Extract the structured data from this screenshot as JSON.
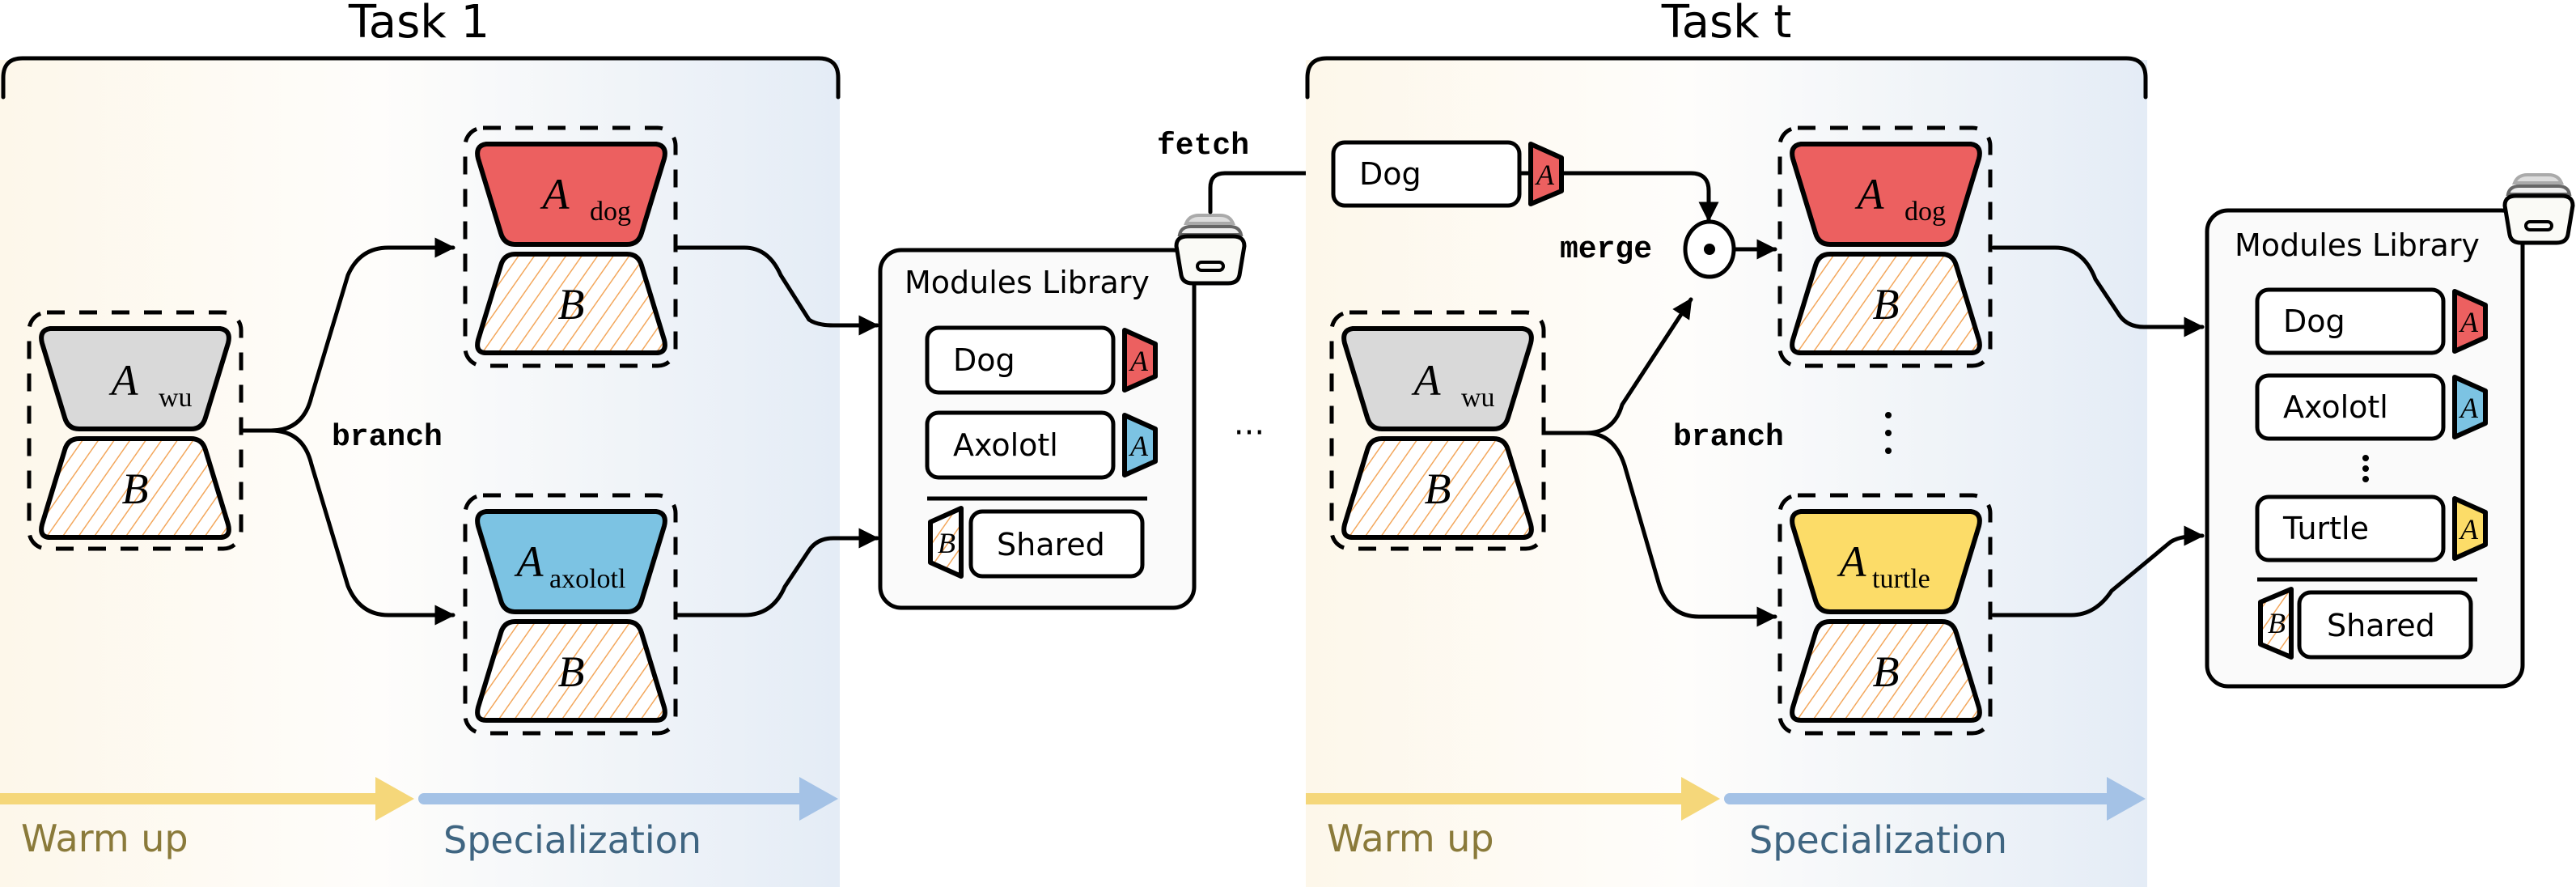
{
  "tasks": [
    {
      "title": "Task 1",
      "warmup_module": {
        "name": "A",
        "sub": "wu",
        "shared": "B",
        "color": "#d9d9d9"
      },
      "branch_label": "branch",
      "specialized": [
        {
          "name": "A",
          "sub": "dog",
          "shared": "B",
          "color": "#ec6060"
        },
        {
          "name": "A",
          "sub": "axolotl",
          "shared": "B",
          "color": "#7cc3e3"
        }
      ],
      "phases": {
        "warmup": "Warm up",
        "specialization": "Specialization"
      }
    },
    {
      "title": "Task t",
      "warmup_module": {
        "name": "A",
        "sub": "wu",
        "shared": "B",
        "color": "#d9d9d9"
      },
      "branch_label": "branch",
      "merge_label": "merge",
      "fetched": {
        "label": "Dog",
        "adapter": "A",
        "color": "#ec6060"
      },
      "specialized": [
        {
          "name": "A",
          "sub": "dog",
          "shared": "B",
          "color": "#ec6060"
        },
        {
          "name": "A",
          "sub": "turtle",
          "shared": "B",
          "color": "#fcdc68"
        }
      ],
      "phases": {
        "warmup": "Warm up",
        "specialization": "Specialization"
      }
    }
  ],
  "fetch_label": "fetch",
  "ellipsis": "···",
  "libraries": [
    {
      "title": "Modules Library",
      "entries": [
        {
          "label": "Dog",
          "adapter": "A",
          "color": "#ec6060"
        },
        {
          "label": "Axolotl",
          "adapter": "A",
          "color": "#7cc3e3"
        }
      ],
      "shared": {
        "label": "Shared",
        "adapter": "B"
      }
    },
    {
      "title": "Modules Library",
      "entries": [
        {
          "label": "Dog",
          "adapter": "A",
          "color": "#ec6060"
        },
        {
          "label": "Axolotl",
          "adapter": "A",
          "color": "#7cc3e3"
        },
        {
          "label": "Turtle",
          "adapter": "A",
          "color": "#fcdc68"
        }
      ],
      "shared": {
        "label": "Shared",
        "adapter": "B"
      }
    }
  ],
  "colors": {
    "warmup_arrow": "#f5d77a",
    "specialization_arrow": "#a4c2e6",
    "warmup_text": "#8a7a3a",
    "specialization_text": "#3f6581",
    "hatch": "#f3a75c"
  }
}
